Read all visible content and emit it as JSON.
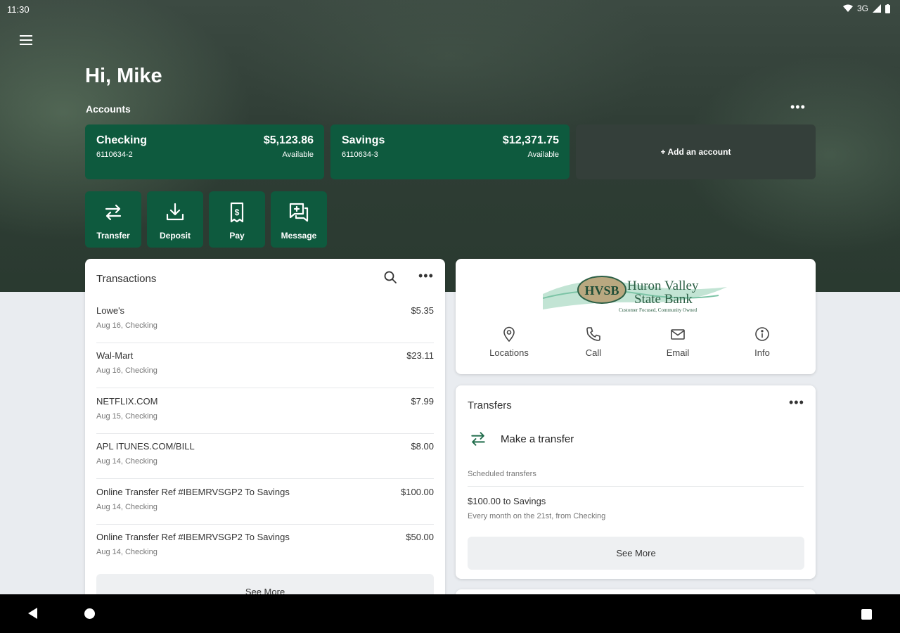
{
  "status_bar": {
    "time": "11:30",
    "network": "3G"
  },
  "greeting": "Hi, Mike",
  "accounts": {
    "label": "Accounts",
    "more": "•••",
    "items": [
      {
        "name": "Checking",
        "number": "6110634-2",
        "balance": "$5,123.86",
        "balance_label": "Available"
      },
      {
        "name": "Savings",
        "number": "6110634-3",
        "balance": "$12,371.75",
        "balance_label": "Available"
      }
    ],
    "add_label": "+ Add an account"
  },
  "quick_actions": [
    {
      "label": "Transfer",
      "icon": "transfer-icon"
    },
    {
      "label": "Deposit",
      "icon": "deposit-icon"
    },
    {
      "label": "Pay",
      "icon": "pay-icon"
    },
    {
      "label": "Message",
      "icon": "message-icon"
    }
  ],
  "transactions": {
    "title": "Transactions",
    "more": "•••",
    "rows": [
      {
        "description": "Lowe's",
        "sub": "Aug 16, Checking",
        "amount": "$5.35"
      },
      {
        "description": "Wal-Mart",
        "sub": "Aug 16, Checking",
        "amount": "$23.11"
      },
      {
        "description": "NETFLIX.COM",
        "sub": "Aug 15, Checking",
        "amount": "$7.99"
      },
      {
        "description": "APL ITUNES.COM/BILL",
        "sub": "Aug 14, Checking",
        "amount": "$8.00"
      },
      {
        "description": "Online Transfer Ref #IBEMRVSGP2 To Savings",
        "sub": "Aug 14, Checking",
        "amount": "$100.00"
      },
      {
        "description": "Online Transfer Ref #IBEMRVSGP2 To Savings",
        "sub": "Aug 14, Checking",
        "amount": "$50.00"
      }
    ],
    "see_more": "See More"
  },
  "bank": {
    "logo_abbr": "HVSB",
    "logo_line1": "Huron Valley",
    "logo_line2": "State Bank",
    "logo_tagline": "Customer Focused, Community Owned",
    "contacts": [
      {
        "label": "Locations",
        "icon": "location-pin-icon"
      },
      {
        "label": "Call",
        "icon": "phone-icon"
      },
      {
        "label": "Email",
        "icon": "email-icon"
      },
      {
        "label": "Info",
        "icon": "info-icon"
      }
    ]
  },
  "transfers": {
    "title": "Transfers",
    "more": "•••",
    "make_label": "Make a transfer",
    "scheduled_label": "Scheduled transfers",
    "scheduled": {
      "amount": "$100.00 to Savings",
      "detail": "Every month on the 21st, from Checking"
    },
    "see_more": "See More"
  },
  "colors": {
    "brand_green": "#0e5a3e",
    "accent_green": "#1f6b4a"
  }
}
